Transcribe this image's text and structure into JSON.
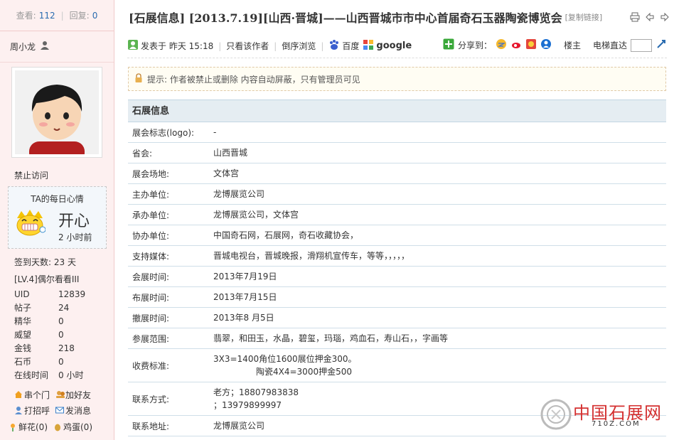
{
  "sidebar": {
    "stats": {
      "views_label": "查看:",
      "views": "112",
      "replies_label": "回复:",
      "replies": "0"
    },
    "author": "周小龙",
    "ban_text": "禁止访问",
    "mood": {
      "title": "TA的每日心情",
      "word": "开心",
      "time": "2 小时前"
    },
    "sign_days": "签到天数: 23 天",
    "level": "[LV.4]偶尔看看III",
    "profile": [
      {
        "k": "UID",
        "v": "12839"
      },
      {
        "k": "帖子",
        "v": "24"
      },
      {
        "k": "精华",
        "v": "0"
      },
      {
        "k": "威望",
        "v": "0"
      },
      {
        "k": "金钱",
        "v": "218"
      },
      {
        "k": "石币",
        "v": "0"
      },
      {
        "k": "在线时间",
        "v": "0 小时"
      }
    ],
    "actions": {
      "visit": "串个门",
      "add_friend": "加好友",
      "greet": "打招呼",
      "message": "发消息"
    },
    "gifts": {
      "flower": "鲜花(0)",
      "egg": "鸡蛋(0)"
    }
  },
  "thread": {
    "title": "[石展信息] [2013.7.19][山西·晋城]——山西晋城市市中心首届奇石玉器陶瓷博览会",
    "copy_link": "[复制链接]"
  },
  "meta": {
    "posted": "发表于 昨天 15:18",
    "author_only": "只看该作者",
    "reverse": "倒序浏览",
    "baidu": "百度",
    "google": "google",
    "share": "分享到：",
    "floor": "楼主",
    "jump": "电梯直达"
  },
  "notice": "提示: 作者被禁止或删除 内容自动屏蔽，只有管理员可见",
  "info": {
    "header": "石展信息",
    "rows": [
      {
        "label": "展会标志(logo):",
        "value": "-"
      },
      {
        "label": "省会:",
        "value": "山西晋城"
      },
      {
        "label": "展会场地:",
        "value": "文体宫"
      },
      {
        "label": "主办单位:",
        "value": "龙博展览公司"
      },
      {
        "label": "承办单位:",
        "value": "龙博展览公司，文体宫"
      },
      {
        "label": "协办单位:",
        "value": "中国奇石网，石展网，奇石收藏协会，"
      },
      {
        "label": "支持媒体:",
        "value": "晋城电视台，晋城晚报，滑翔机宣传车，等等，，，，，"
      },
      {
        "label": "会展时间:",
        "value": "2013年7月19日"
      },
      {
        "label": "布展时间:",
        "value": "2013年7月15日"
      },
      {
        "label": "撤展时间:",
        "value": "2013年8 月5日"
      },
      {
        "label": "参展范围:",
        "value": "翡翠，和田玉，水晶，碧玺，玛瑙，鸡血石，寿山石，，字画等"
      },
      {
        "label": "收费标准:",
        "value": "3X3=1400角位1600展位押金300。",
        "value2": "陶瓷4X4=3000押金500"
      },
      {
        "label": "联系方式:",
        "value": "老方；18807983838",
        "value2": "；13979899997"
      },
      {
        "label": "联系地址:",
        "value": "龙博展览公司"
      }
    ]
  },
  "watermark": {
    "name": "中国石展网",
    "url": "710Z.COM"
  }
}
